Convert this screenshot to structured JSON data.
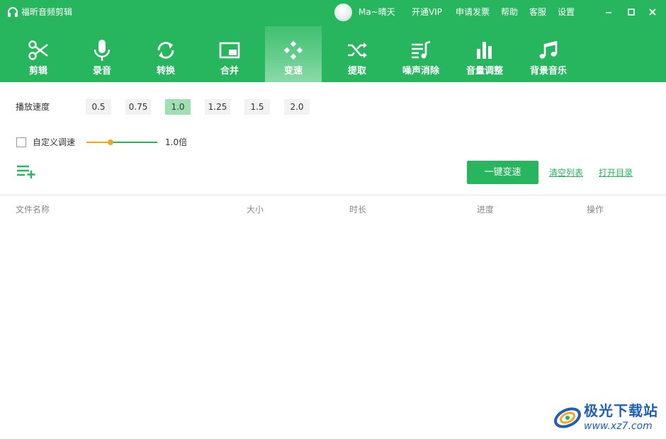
{
  "app": {
    "title": "福昕音频剪辑",
    "accent": "#27b65e"
  },
  "titlebar": {
    "username": "Ma~晴天",
    "links": [
      "开通VIP",
      "申请发票",
      "帮助",
      "客服",
      "设置"
    ]
  },
  "toolbar": {
    "tools": [
      {
        "label": "剪辑",
        "icon": "scissors-icon"
      },
      {
        "label": "录音",
        "icon": "microphone-icon"
      },
      {
        "label": "转换",
        "icon": "convert-icon"
      },
      {
        "label": "合并",
        "icon": "merge-icon"
      },
      {
        "label": "变速",
        "icon": "gamepad-icon",
        "active": true
      },
      {
        "label": "提取",
        "icon": "shuffle-icon"
      },
      {
        "label": "噪声消除",
        "icon": "noise-icon"
      },
      {
        "label": "音量调整",
        "icon": "volume-bars-icon"
      },
      {
        "label": "背景音乐",
        "icon": "music-note-icon"
      }
    ]
  },
  "speed": {
    "label": "播放速度",
    "options": [
      "0.5",
      "0.75",
      "1.0",
      "1.25",
      "1.5",
      "2.0"
    ],
    "selected": "1.0"
  },
  "custom_speed": {
    "label": "自定义调速",
    "checked": false,
    "value_text": "1.0倍",
    "slider_fraction": 0.34
  },
  "actions": {
    "primary": "一键变速",
    "clear": "清空列表",
    "open_dir": "打开目录"
  },
  "table": {
    "columns": [
      "文件名称",
      "大小",
      "时长",
      "进度",
      "操作"
    ]
  },
  "watermark": {
    "text": "极光下载站",
    "url": "www.xz7.com"
  }
}
